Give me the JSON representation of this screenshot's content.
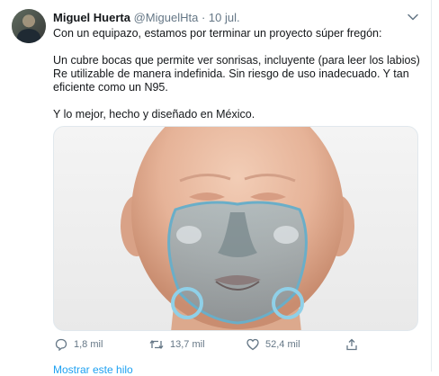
{
  "tweet": {
    "author_name": "Miguel Huerta",
    "handle": "@MiguelHta",
    "separator": "·",
    "date": "10 jul.",
    "lines": [
      "Con un equipazo, estamos por terminar un proyecto súper fregón:",
      "Un cubre bocas que permite ver sonrisas, incluyente (para leer los labios)",
      "Re utilizable de manera indefinida. Sin riesgo de uso inadecuado. Y tan",
      "eficiente como un N95.",
      "Y lo mejor, hecho y diseñado en México."
    ]
  },
  "actions": {
    "reply_count": "1,8 mil",
    "retweet_count": "13,7 mil",
    "like_count": "52,4 mil"
  },
  "footer": {
    "link_text": "Mostrar este hilo"
  },
  "colors": {
    "accent": "#1da1f2",
    "muted": "#657786",
    "text": "#14171a"
  }
}
